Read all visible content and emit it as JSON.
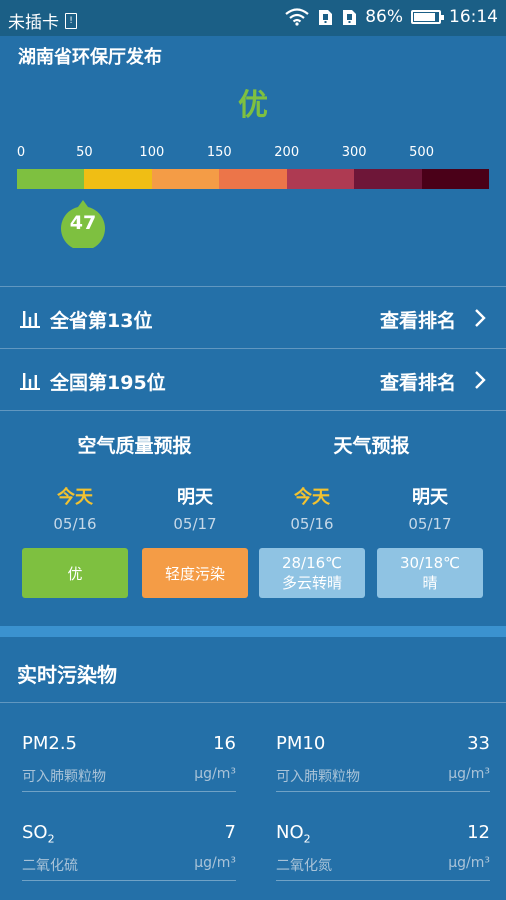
{
  "status_bar": {
    "carrier": "未插卡",
    "sim_glyph": "!",
    "battery": "86%",
    "battery_level": 0.86,
    "time": "16:14"
  },
  "publisher": "湖南省环保厅发布",
  "aqi": {
    "level": "优",
    "value": "47",
    "level_color": "#7ec040"
  },
  "scale": {
    "labels": [
      "0",
      "50",
      "100",
      "150",
      "200",
      "300",
      "500"
    ],
    "colors": [
      "#7ec040",
      "#f0be14",
      "#f49c46",
      "#ec7549",
      "#ae3a52",
      "#6e1638",
      "#4a0018"
    ]
  },
  "ranks": [
    {
      "text": "全省第13位",
      "link": "查看排名"
    },
    {
      "text": "全国第195位",
      "link": "查看排名"
    }
  ],
  "forecast": {
    "air_title": "空气质量预报",
    "weather_title": "天气预报",
    "air": [
      {
        "day": "今天",
        "date": "05/16",
        "label": "优",
        "color": "#7ec040"
      },
      {
        "day": "明天",
        "date": "05/17",
        "label": "轻度污染",
        "color": "#f49c46"
      }
    ],
    "weather": [
      {
        "day": "今天",
        "date": "05/16",
        "temp": "28/16℃",
        "desc": "多云转晴"
      },
      {
        "day": "明天",
        "date": "05/17",
        "temp": "30/18℃",
        "desc": "晴"
      }
    ],
    "today_color": "#f2c230"
  },
  "pollutants": {
    "title": "实时污染物",
    "items": [
      {
        "name": "PM2.5",
        "value": "16",
        "desc": "可入肺颗粒物",
        "unit": "μg/m³"
      },
      {
        "name": "PM10",
        "value": "33",
        "desc": "可入肺颗粒物",
        "unit": "μg/m³"
      },
      {
        "name": "SO",
        "sub": "2",
        "value": "7",
        "desc": "二氧化硫",
        "unit": "μg/m³"
      },
      {
        "name": "NO",
        "sub": "2",
        "value": "12",
        "desc": "二氧化氮",
        "unit": "μg/m³"
      }
    ]
  }
}
